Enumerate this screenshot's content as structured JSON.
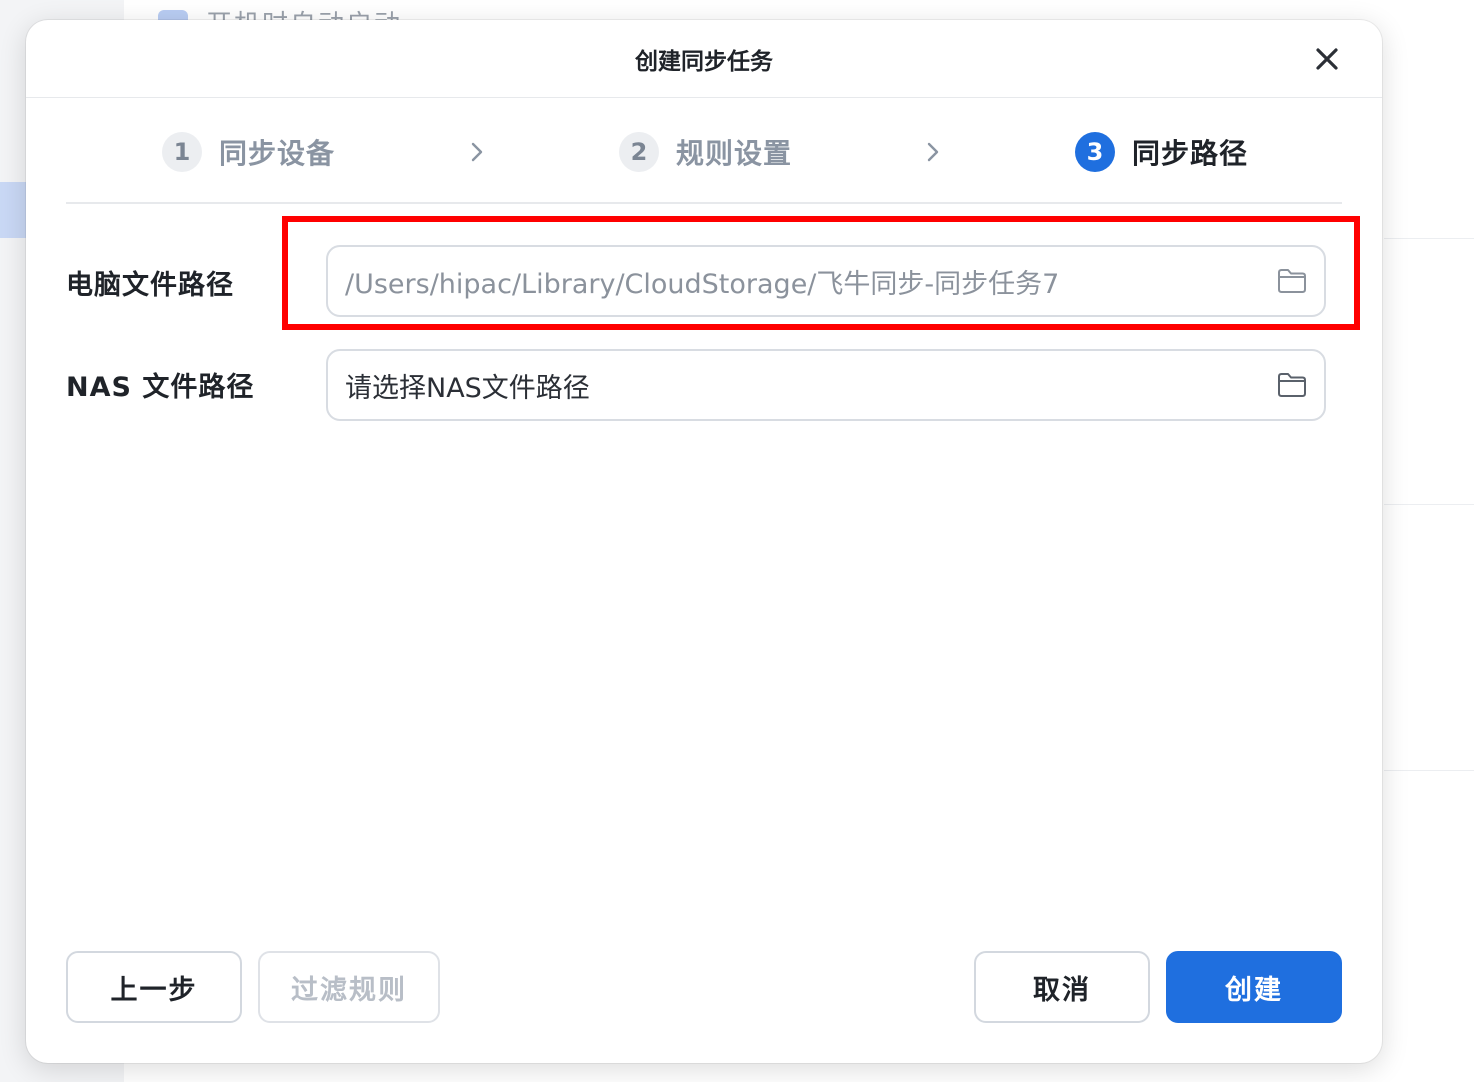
{
  "background": {
    "checkbox_text": "开机时自动启动"
  },
  "dialog": {
    "title": "创建同步任务",
    "close_icon": "close-icon"
  },
  "steps": [
    {
      "number": "1",
      "label": "同步设备",
      "state": "done"
    },
    {
      "number": "2",
      "label": "规则设置",
      "state": "done"
    },
    {
      "number": "3",
      "label": "同步路径",
      "state": "active"
    }
  ],
  "form": {
    "local_path": {
      "label": "电脑文件路径",
      "value": "/Users/hipac/Library/CloudStorage/飞牛同步-同步任务7",
      "icon": "folder-icon"
    },
    "nas_path": {
      "label": "NAS 文件路径",
      "placeholder": "请选择NAS文件路径",
      "icon": "folder-icon"
    }
  },
  "footer": {
    "prev_label": "上一步",
    "filter_label": "过滤规则",
    "cancel_label": "取消",
    "create_label": "创建"
  },
  "colors": {
    "accent": "#1f6fdf",
    "highlight": "#ff0000"
  }
}
